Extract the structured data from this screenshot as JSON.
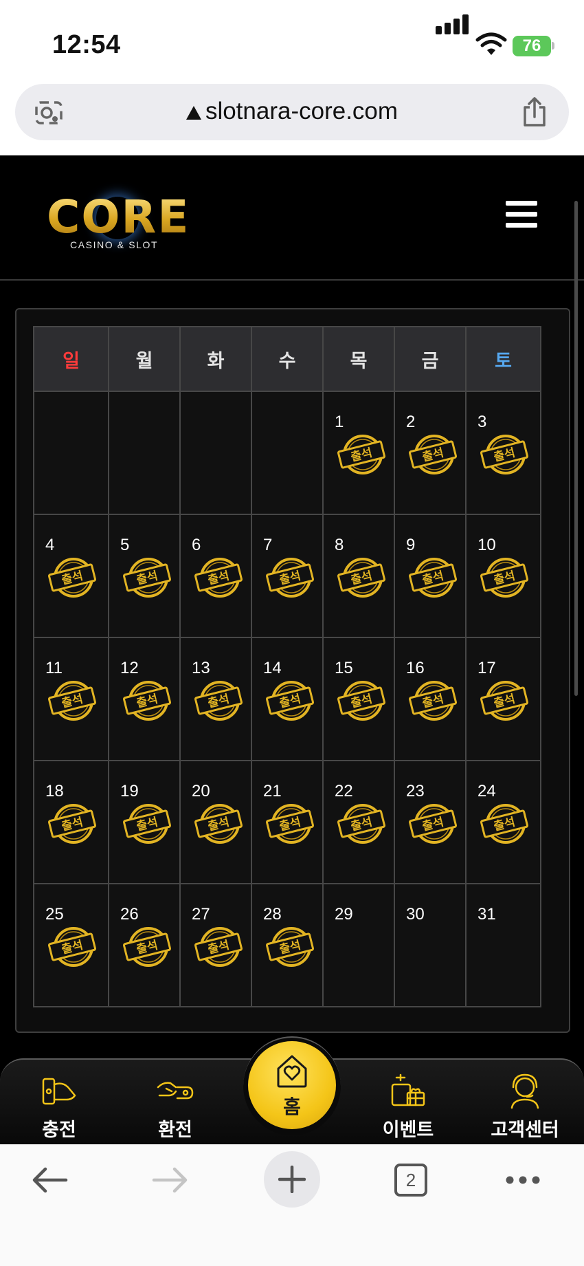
{
  "status_bar": {
    "time": "12:54",
    "battery": "76"
  },
  "browser": {
    "url": "slotnara-core.com",
    "tab_count": "2"
  },
  "site": {
    "logo": {
      "main": "CORE",
      "sub": "CASINO & SLOT"
    }
  },
  "calendar": {
    "weekdays": [
      "일",
      "월",
      "화",
      "수",
      "목",
      "금",
      "토"
    ],
    "stamp_label": "출석",
    "weeks": [
      [
        null,
        null,
        null,
        null,
        {
          "day": "1",
          "stamped": true
        },
        {
          "day": "2",
          "stamped": true
        },
        {
          "day": "3",
          "stamped": true
        }
      ],
      [
        {
          "day": "4",
          "stamped": true
        },
        {
          "day": "5",
          "stamped": true
        },
        {
          "day": "6",
          "stamped": true
        },
        {
          "day": "7",
          "stamped": true
        },
        {
          "day": "8",
          "stamped": true
        },
        {
          "day": "9",
          "stamped": true
        },
        {
          "day": "10",
          "stamped": true
        }
      ],
      [
        {
          "day": "11",
          "stamped": true
        },
        {
          "day": "12",
          "stamped": true
        },
        {
          "day": "13",
          "stamped": true
        },
        {
          "day": "14",
          "stamped": true
        },
        {
          "day": "15",
          "stamped": true
        },
        {
          "day": "16",
          "stamped": true
        },
        {
          "day": "17",
          "stamped": true
        }
      ],
      [
        {
          "day": "18",
          "stamped": true
        },
        {
          "day": "19",
          "stamped": true
        },
        {
          "day": "20",
          "stamped": true
        },
        {
          "day": "21",
          "stamped": true
        },
        {
          "day": "22",
          "stamped": true
        },
        {
          "day": "23",
          "stamped": true
        },
        {
          "day": "24",
          "stamped": true
        }
      ],
      [
        {
          "day": "25",
          "stamped": true
        },
        {
          "day": "26",
          "stamped": true
        },
        {
          "day": "27",
          "stamped": true
        },
        {
          "day": "28",
          "stamped": true
        },
        {
          "day": "29",
          "stamped": false
        },
        {
          "day": "30",
          "stamped": false
        },
        {
          "day": "31",
          "stamped": false
        }
      ]
    ]
  },
  "bottom_nav": {
    "deposit": "충전",
    "withdraw": "환전",
    "home": "홈",
    "event": "이벤트",
    "support": "고객센터"
  },
  "colors": {
    "gold": "#f4c518",
    "sunday": "#ff3b3b",
    "saturday": "#56a8f0"
  }
}
